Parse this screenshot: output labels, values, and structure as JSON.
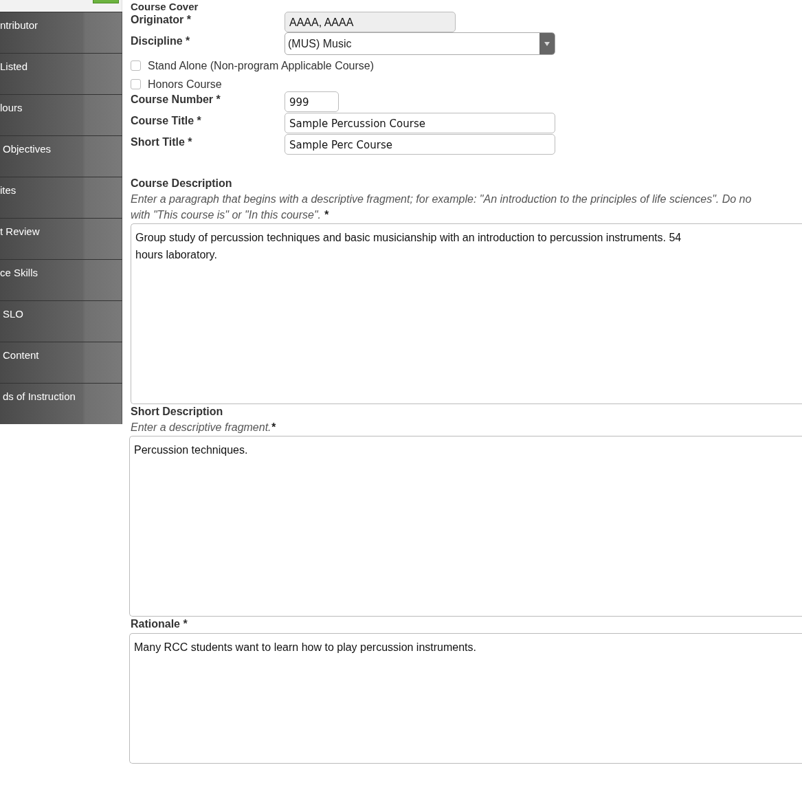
{
  "sidebar": {
    "items": [
      {
        "label": "ntributor"
      },
      {
        "label": "Listed"
      },
      {
        "label": "lours"
      },
      {
        "label": "Objectives"
      },
      {
        "label": "ites"
      },
      {
        "label": "t Review"
      },
      {
        "label": "ce Skills"
      },
      {
        "label": "SLO"
      },
      {
        "label": "Content"
      },
      {
        "label": "ds of Instruction"
      }
    ]
  },
  "section_title": "Course Cover",
  "fields": [
    {
      "kind": "readonly",
      "label": "Originator *",
      "value": "AAAA, AAAA"
    },
    {
      "kind": "select",
      "label": "Discipline *",
      "value": "(MUS) Music"
    },
    {
      "kind": "checkbox",
      "label": "Stand Alone (Non-program Applicable Course)",
      "checked": false
    },
    {
      "kind": "checkbox",
      "label": "Honors Course",
      "checked": false
    },
    {
      "kind": "text",
      "label": "Course Number *",
      "value": "999"
    },
    {
      "kind": "text",
      "label": "Course Title *",
      "value": "Sample Percussion Course"
    },
    {
      "kind": "text",
      "label": "Short Title *",
      "value": "Sample Perc Course"
    }
  ],
  "text_areas": [
    {
      "label": "Course Description",
      "hint": "Enter a paragraph that begins with a descriptive fragment; for example: \"An introduction to the principles of life sciences\". Do no",
      "hint_2": "with \"This course is\" or \"In this course\".",
      "required_mark": "*",
      "value": "Group study of percussion techniques and basic musicianship with an introduction to percussion instruments. 54",
      "value_2": "hours laboratory."
    },
    {
      "label": "Short Description",
      "hint": "Enter a descriptive fragment.",
      "required_mark": "*",
      "value": "Percussion techniques."
    },
    {
      "label": "Rationale *",
      "value": "Many RCC students want to learn how to play percussion instruments."
    }
  ]
}
